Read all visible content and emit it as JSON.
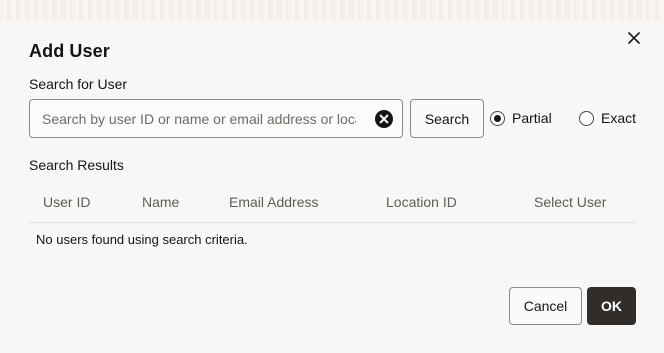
{
  "dialog": {
    "title": "Add User",
    "close_icon": "close-icon"
  },
  "search": {
    "label": "Search for User",
    "placeholder": "Search by user ID or name or email address or location ID",
    "value": "",
    "clear_icon": "clear-circle-x-icon",
    "button_label": "Search",
    "match_options": [
      {
        "label": "Partial",
        "selected": true
      },
      {
        "label": "Exact",
        "selected": false
      }
    ]
  },
  "results": {
    "label": "Search Results",
    "columns": [
      "User ID",
      "Name",
      "Email Address",
      "Location ID",
      "Select User"
    ],
    "empty_message": "No users found using search criteria."
  },
  "footer": {
    "cancel_label": "Cancel",
    "ok_label": "OK"
  },
  "colors": {
    "background": "#f9f7f5",
    "primary_button": "#312d2a",
    "border": "#8e8a85"
  }
}
